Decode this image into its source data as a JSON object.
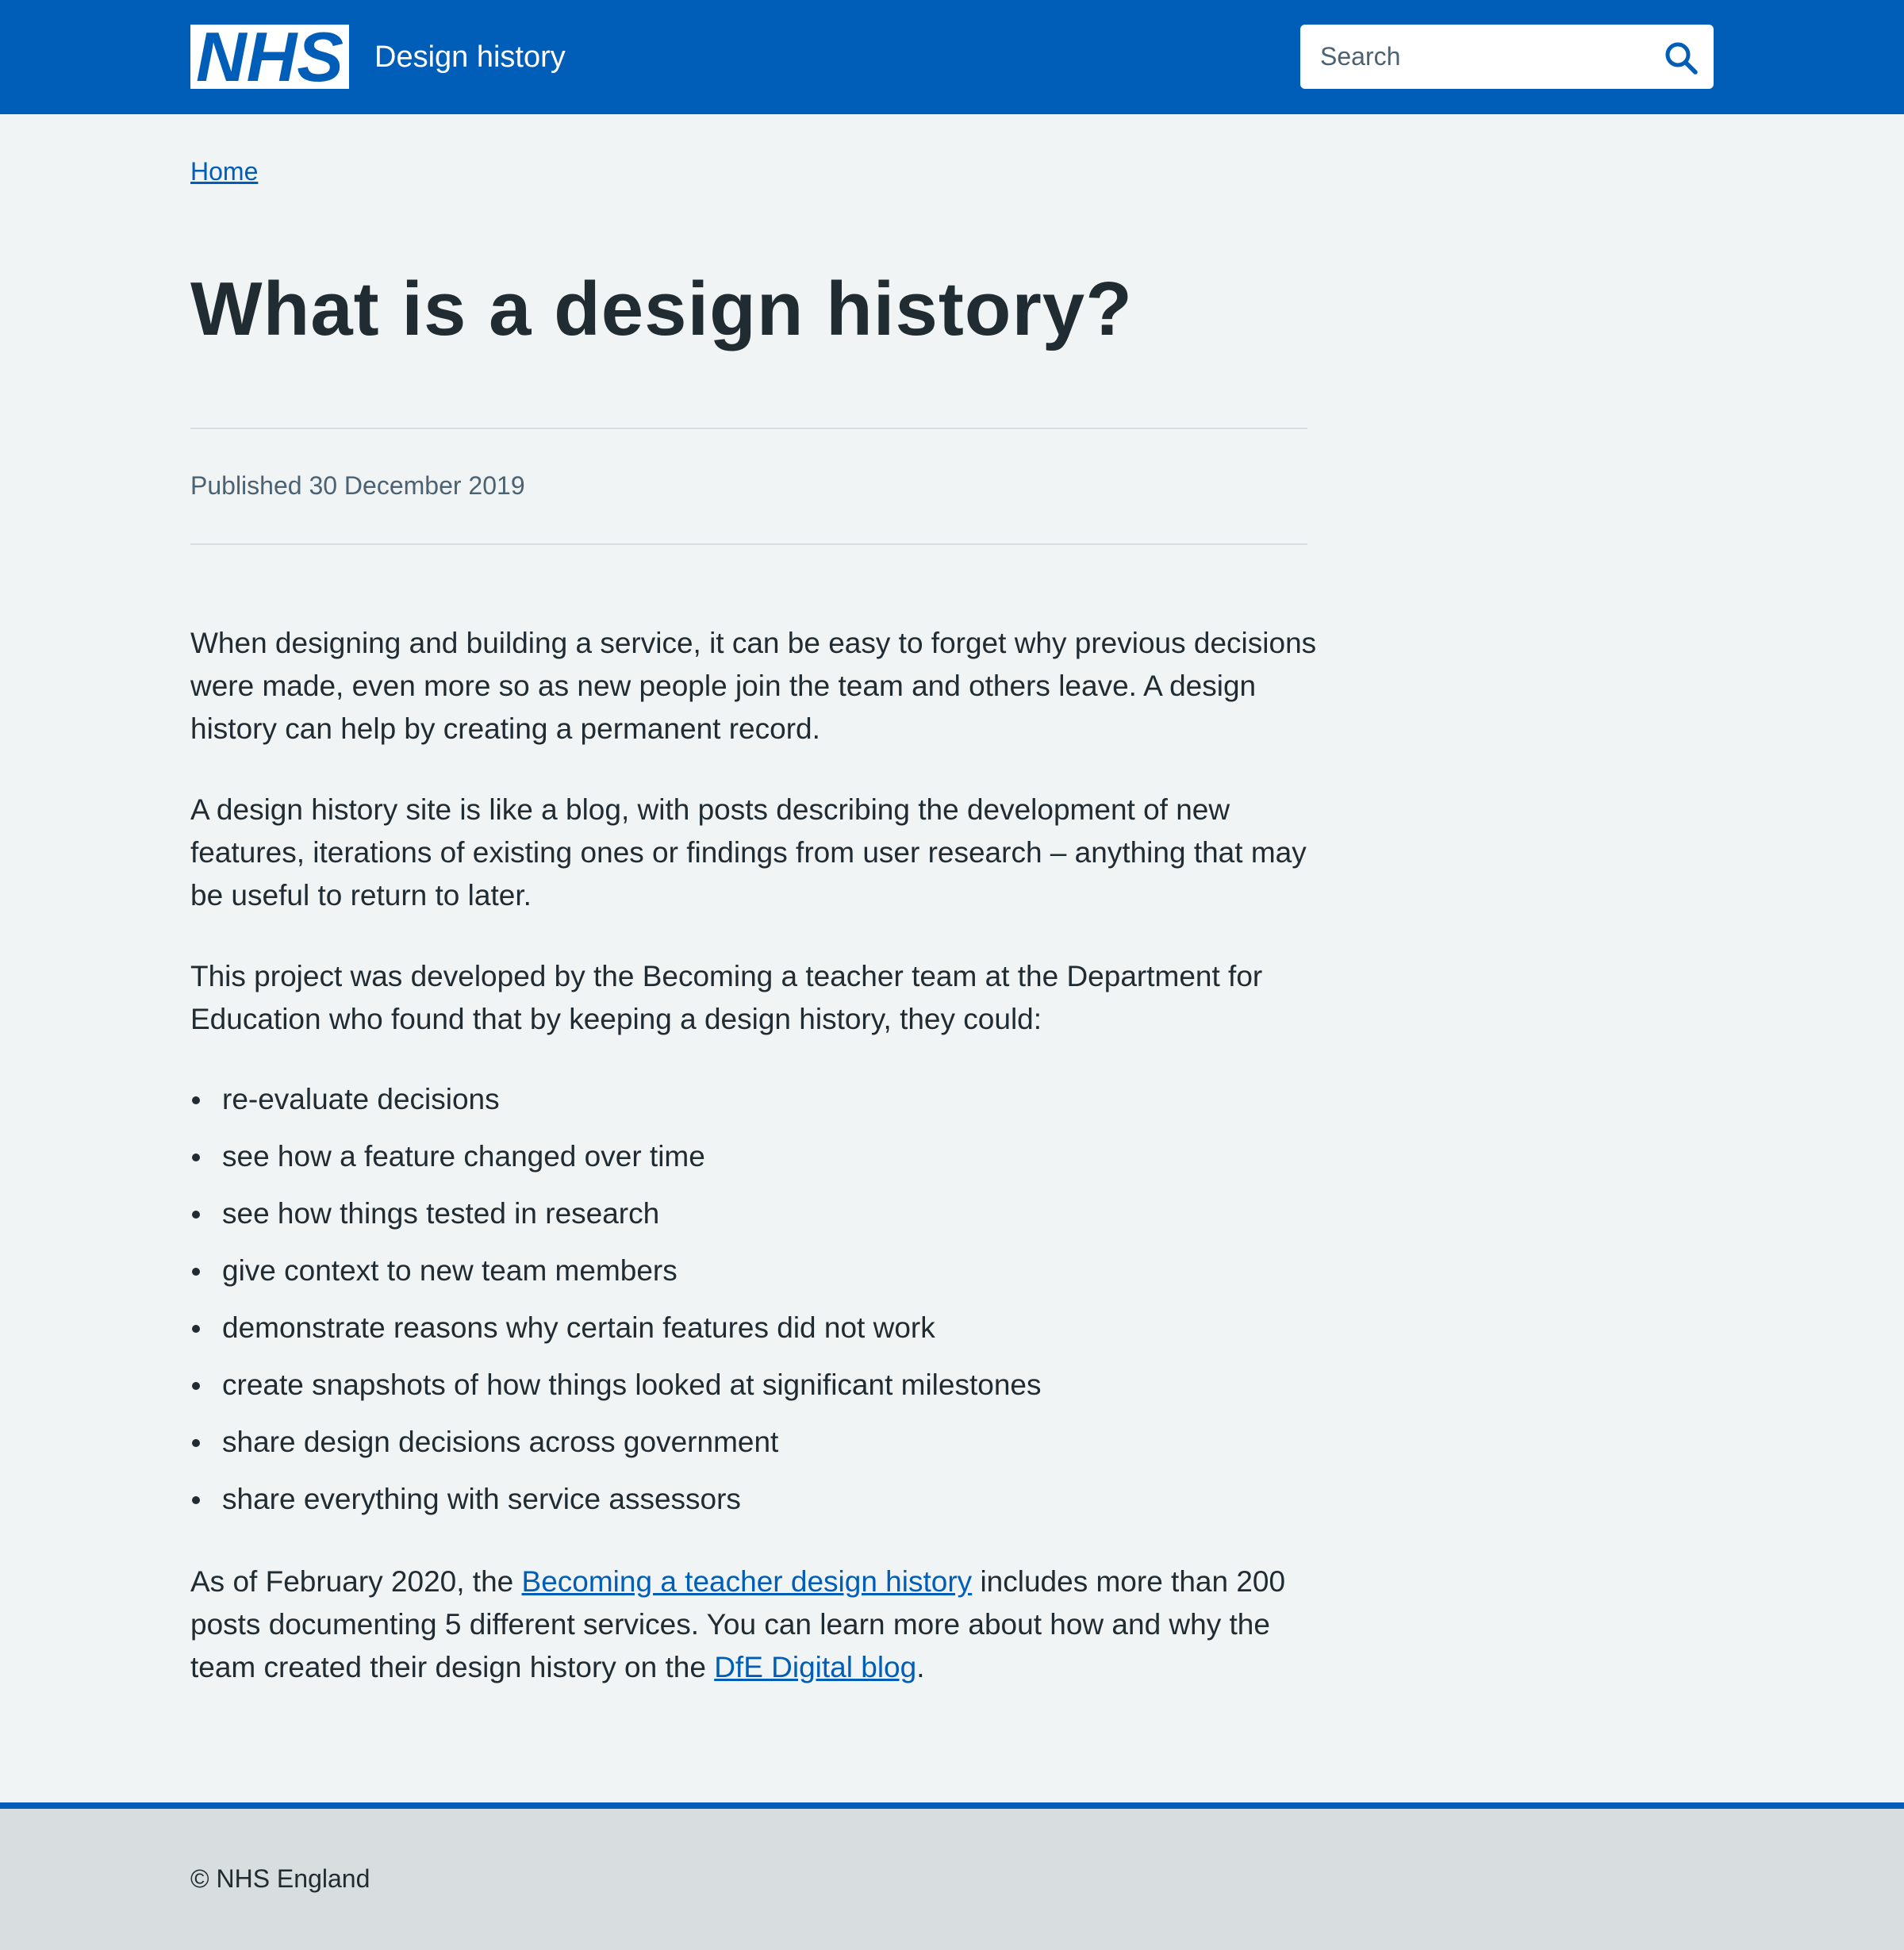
{
  "header": {
    "logo_text": "NHS",
    "service_name": "Design history",
    "search": {
      "placeholder": "Search",
      "button_label": "Search"
    }
  },
  "breadcrumb": {
    "home": "Home"
  },
  "article": {
    "title": "What is a design history?",
    "published": "Published 30 December 2019",
    "paragraphs": [
      "When designing and building a service, it can be easy to forget why previous decisions were made, even more so as new people join the team and others leave. A design history can help by creating a permanent record.",
      "A design history site is like a blog, with posts describing the development of new features, iterations of existing ones or findings from user research – anything that may be useful to return to later.",
      "This project was developed by the Becoming a teacher team at the Department for Education who found that by keeping a design history, they could:"
    ],
    "list": [
      "re-evaluate decisions",
      "see how a feature changed over time",
      "see how things tested in research",
      "give context to new team members",
      "demonstrate reasons why certain features did not work",
      "create snapshots of how things looked at significant milestones",
      "share design decisions across government",
      "share everything with service assessors"
    ],
    "closing": {
      "text_1": "As of February 2020, the ",
      "link_1": "Becoming a teacher design history",
      "text_2": " includes more than 200 posts documenting 5 different services. You can learn more about how and why the team created their design history on the ",
      "link_2": "DfE Digital blog",
      "text_3": "."
    }
  },
  "footer": {
    "copyright": "© NHS England"
  },
  "colors": {
    "brand_blue": "#005eb8",
    "page_background": "#f0f4f5",
    "text": "#212b32",
    "secondary_text": "#4c6272",
    "footer_background": "#d8dde0"
  }
}
